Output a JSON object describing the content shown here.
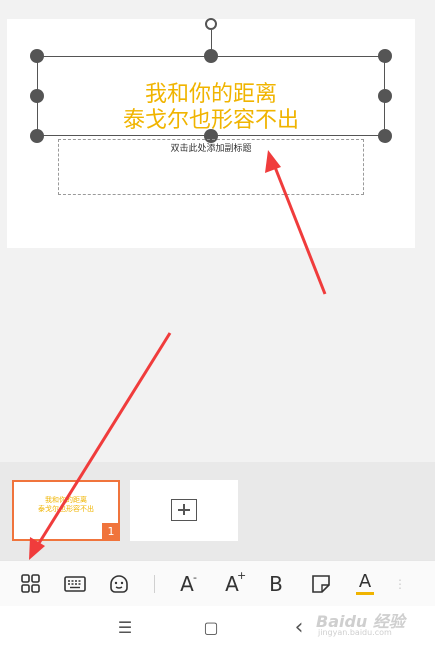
{
  "slide": {
    "title_lines": [
      "我和你的距离",
      "泰戈尔也形容不出"
    ],
    "subtitle_placeholder": "双击此处添加副标题"
  },
  "thumbnails": [
    {
      "title_lines": [
        "我和你的距离",
        "泰戈尔也形容不出"
      ],
      "number": "1",
      "selected": true
    }
  ],
  "toolbar": {
    "items": [
      {
        "icon": "layout-grid-icon"
      },
      {
        "icon": "keyboard-icon"
      },
      {
        "icon": "smiley-icon"
      },
      {
        "label": "A",
        "icon": "decrease-font-icon"
      },
      {
        "label": "A",
        "icon": "increase-font-icon"
      },
      {
        "label": "B",
        "icon": "bold-icon"
      },
      {
        "icon": "shape-style-icon"
      },
      {
        "label": "A",
        "icon": "font-color-icon"
      }
    ]
  },
  "system_nav": {
    "menu": "☰",
    "home": "▢",
    "back": "‹"
  },
  "watermark": {
    "main": "Baidu 经验",
    "sub": "jingyan.baidu.com"
  },
  "colors": {
    "title": "#f0b400",
    "accent": "#f0743c",
    "arrow": "#f03c3c"
  }
}
